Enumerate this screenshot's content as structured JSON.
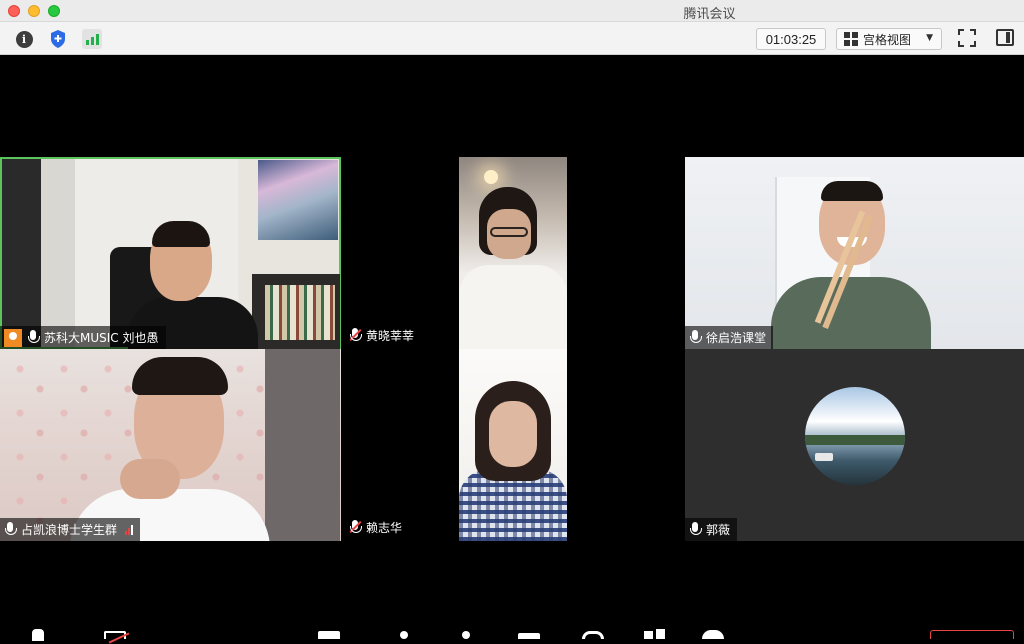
{
  "window": {
    "title": "腾讯会议"
  },
  "toolbar": {
    "info_icon": "info-icon",
    "shield_icon": "shield-icon",
    "signal_icon": "signal-icon",
    "timer": "01:03:25",
    "view_label": "宫格视图",
    "view_icon": "grid-icon",
    "fullscreen_icon": "fullscreen-icon",
    "sidebar_icon": "sidebar-icon"
  },
  "participants": [
    {
      "name": "苏科大MUSIC 刘也愚",
      "mic": "on",
      "host_badge": true,
      "active_speaker": true
    },
    {
      "name": "黄晓莘莘",
      "mic": "muted"
    },
    {
      "name": "徐启浩课堂",
      "mic": "on"
    },
    {
      "name": "占凯浪博士学生群",
      "mic": "on",
      "weak_signal": true
    },
    {
      "name": "赖志华",
      "mic": "muted"
    },
    {
      "name": "郭薇",
      "mic": "on",
      "camera": "off"
    }
  ],
  "colors": {
    "active_border": "#5bc45b",
    "muted_mic": "#e84545",
    "host_badge": "#f08a24",
    "signal_good": "#22b14c"
  }
}
